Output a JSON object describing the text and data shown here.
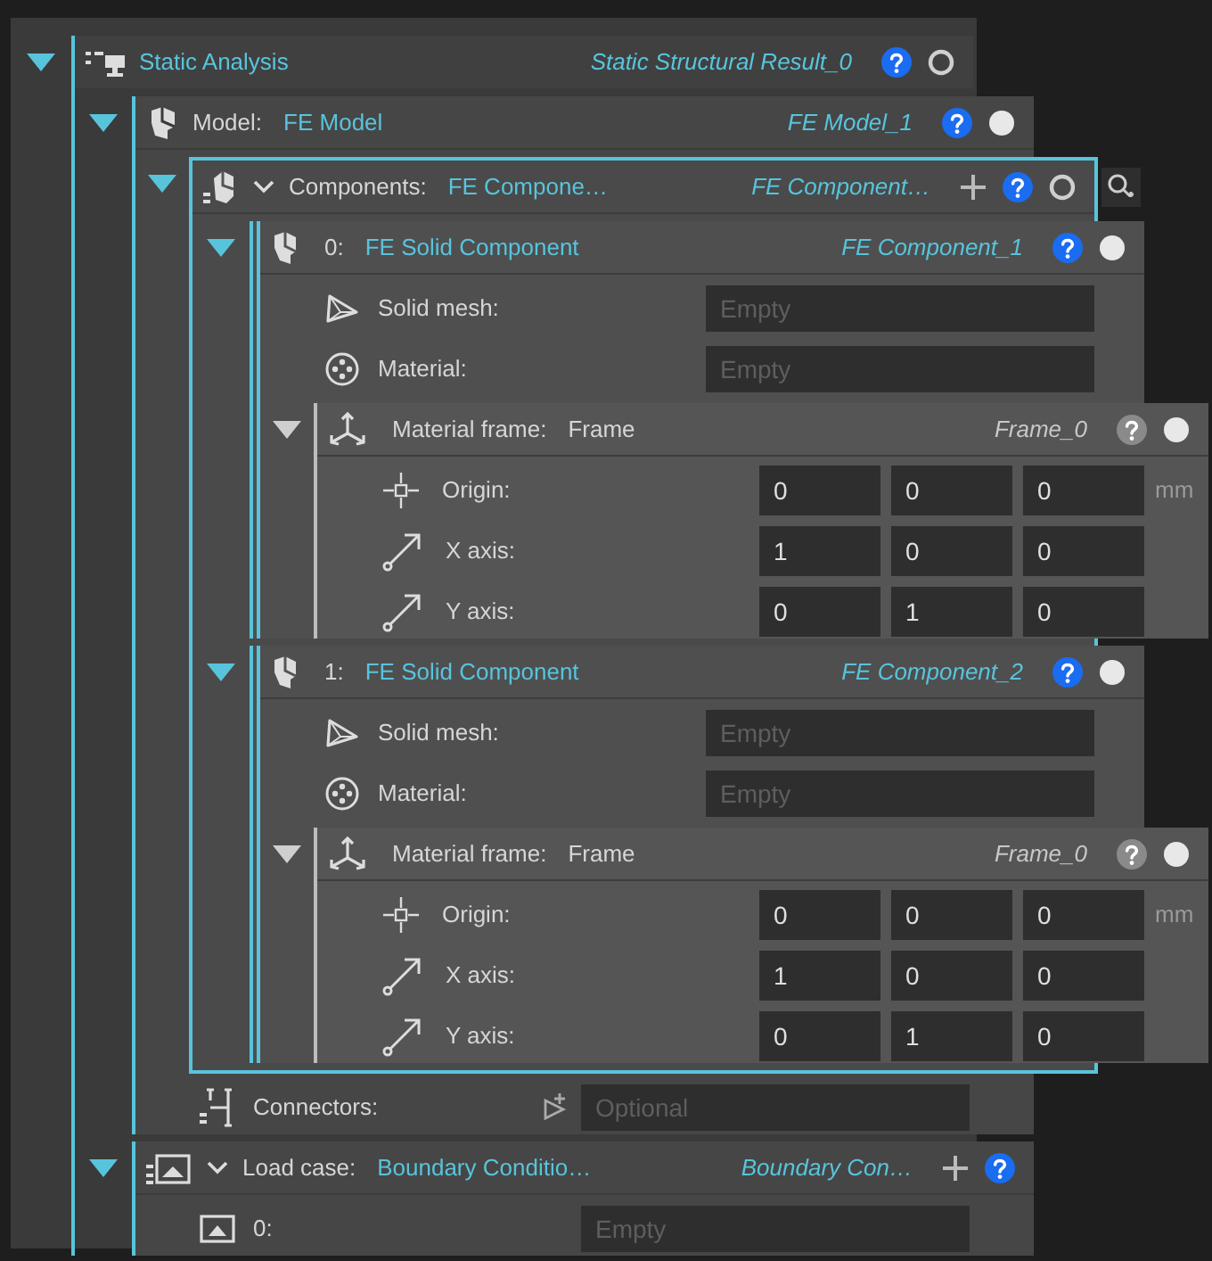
{
  "tree": {
    "kind": "analysis",
    "label": "Static Analysis",
    "instance": "Static Structural Result_0",
    "expanded": true,
    "filled": false,
    "children": [
      {
        "kind": "model",
        "label": "Model:",
        "value": "FE Model",
        "instance": "FE Model_1",
        "expanded": true,
        "filled": true,
        "children": [
          {
            "kind": "components",
            "label": "Components:",
            "value": "FE Compone…",
            "instance": "FE Component…",
            "expanded": true,
            "filled": false,
            "can_add": true,
            "children": [
              {
                "kind": "component",
                "label": "0:",
                "value": "FE Solid Component",
                "instance": "FE Component_1",
                "expanded": true,
                "filled": true,
                "children": [
                  {
                    "kind": "field",
                    "label": "Solid mesh:",
                    "placeholder": "Empty"
                  },
                  {
                    "kind": "field",
                    "label": "Material:",
                    "placeholder": "Empty"
                  },
                  {
                    "kind": "frame",
                    "label": "Material frame:",
                    "value": "Frame",
                    "instance": "Frame_0",
                    "expanded": true,
                    "filled": true,
                    "children": [
                      {
                        "kind": "vector",
                        "label": "Origin:",
                        "values": [
                          "0",
                          "0",
                          "0"
                        ],
                        "unit": "mm"
                      },
                      {
                        "kind": "vector",
                        "label": "X axis:",
                        "values": [
                          "1",
                          "0",
                          "0"
                        ]
                      },
                      {
                        "kind": "vector",
                        "label": "Y axis:",
                        "values": [
                          "0",
                          "1",
                          "0"
                        ]
                      }
                    ]
                  }
                ]
              },
              {
                "kind": "component",
                "label": "1:",
                "value": "FE Solid Component",
                "instance": "FE Component_2",
                "expanded": true,
                "filled": true,
                "children": [
                  {
                    "kind": "field",
                    "label": "Solid mesh:",
                    "placeholder": "Empty"
                  },
                  {
                    "kind": "field",
                    "label": "Material:",
                    "placeholder": "Empty"
                  },
                  {
                    "kind": "frame",
                    "label": "Material frame:",
                    "value": "Frame",
                    "instance": "Frame_0",
                    "expanded": true,
                    "filled": true,
                    "children": [
                      {
                        "kind": "vector",
                        "label": "Origin:",
                        "values": [
                          "0",
                          "0",
                          "0"
                        ],
                        "unit": "mm"
                      },
                      {
                        "kind": "vector",
                        "label": "X axis:",
                        "values": [
                          "1",
                          "0",
                          "0"
                        ]
                      },
                      {
                        "kind": "vector",
                        "label": "Y axis:",
                        "values": [
                          "0",
                          "1",
                          "0"
                        ]
                      }
                    ]
                  }
                ]
              }
            ]
          },
          {
            "kind": "field",
            "label": "Connectors:",
            "placeholder": "Optional"
          }
        ]
      },
      {
        "kind": "load_case",
        "label": "Load case:",
        "value": "Boundary Conditio…",
        "instance": "Boundary Con…",
        "expanded": true,
        "can_add": true,
        "children": [
          {
            "kind": "field",
            "label": "0:",
            "placeholder": "Empty"
          }
        ]
      }
    ]
  }
}
